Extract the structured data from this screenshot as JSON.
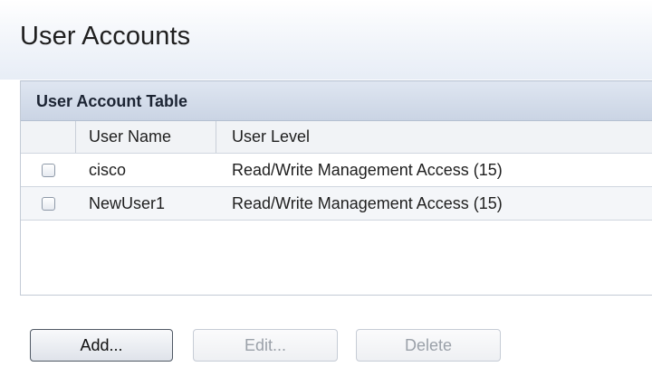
{
  "page": {
    "title": "User Accounts"
  },
  "table": {
    "title": "User Account Table",
    "columns": [
      "User Name",
      "User Level"
    ],
    "rows": [
      {
        "user_name": "cisco",
        "user_level": "Read/Write Management Access (15)"
      },
      {
        "user_name": "NewUser1",
        "user_level": "Read/Write Management Access (15)"
      }
    ]
  },
  "toolbar": {
    "add_label": "Add...",
    "edit_label": "Edit...",
    "delete_label": "Delete"
  },
  "colors": {
    "header_band": "#cad4e4",
    "primary_button_border": "#4f5864",
    "disabled_text": "#9ba1a9"
  }
}
